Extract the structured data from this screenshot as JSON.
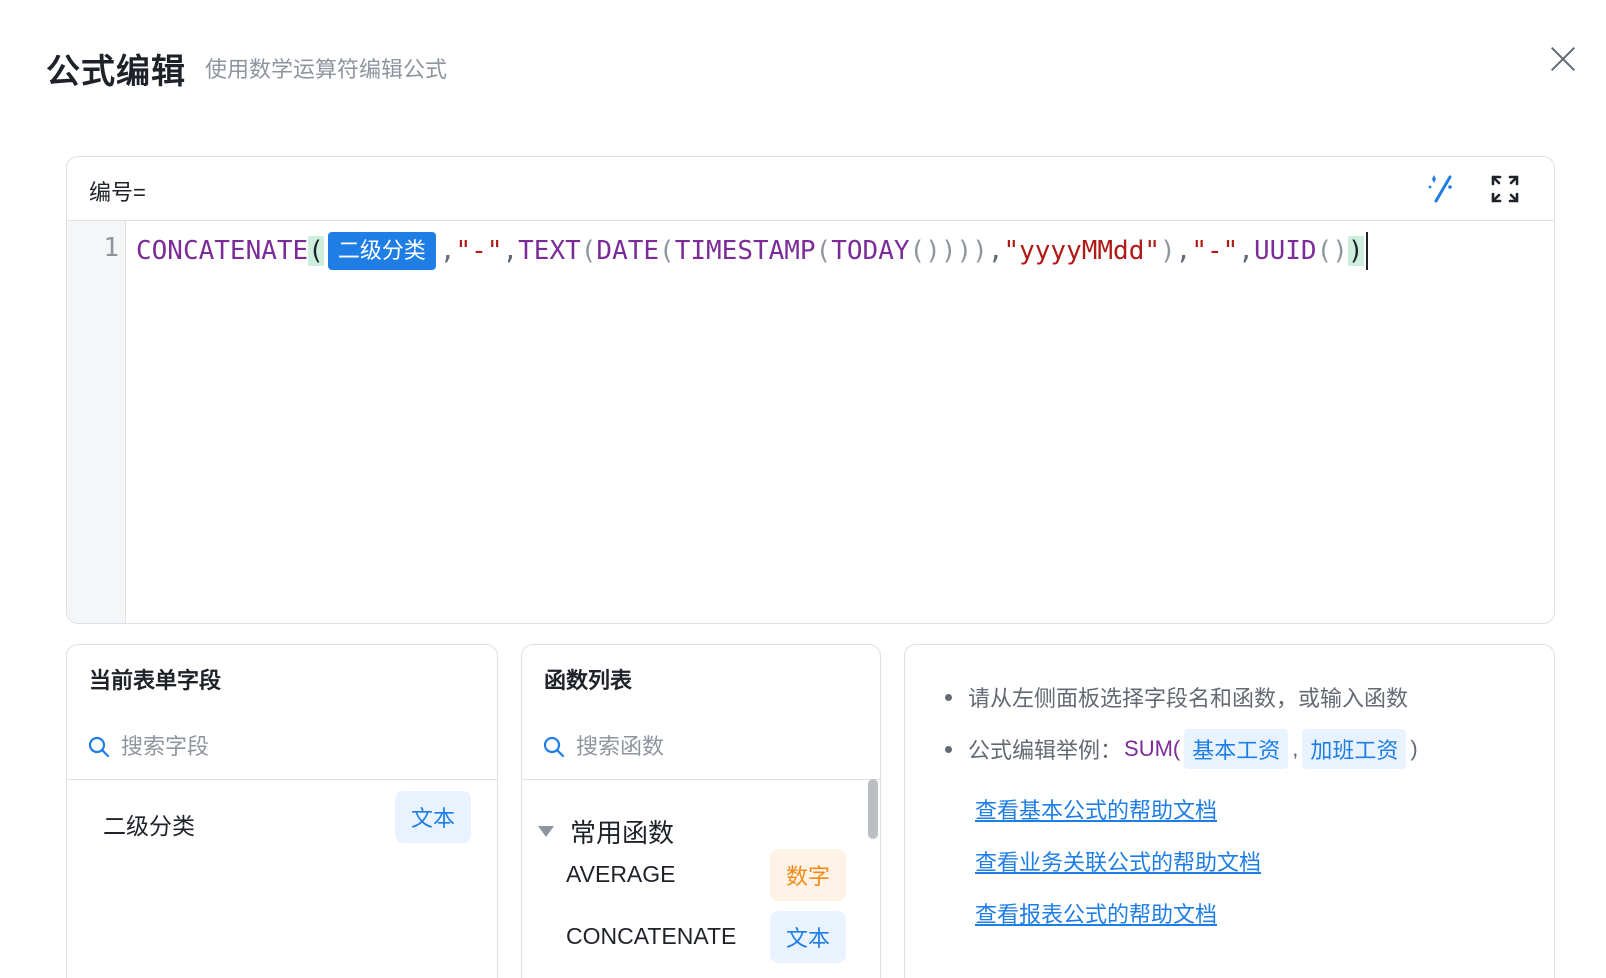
{
  "dialog": {
    "title": "公式编辑",
    "subtitle": "使用数学运算符编辑公式"
  },
  "editor": {
    "label": "编号=",
    "line_number": "1",
    "tokens": {
      "fn1": "CONCATENATE",
      "open1": "(",
      "field": "二级分类",
      "comma1": ",",
      "str1": "\"-\"",
      "comma2": ",",
      "fn2": "TEXT",
      "open2": "(",
      "fn3": "DATE",
      "open3": "(",
      "fn4": "TIMESTAMP",
      "open4": "(",
      "fn5": "TODAY",
      "parens5": "()",
      "close_run": ")))",
      "comma3": ",",
      "str2": "\"yyyyMMdd\"",
      "close2": ")",
      "comma4": ",",
      "str3": "\"-\"",
      "comma5": ",",
      "fn6": "UUID",
      "parens6": "()",
      "close1": ")"
    }
  },
  "fields_panel": {
    "title": "当前表单字段",
    "search_placeholder": "搜索字段",
    "items": [
      {
        "name": "二级分类",
        "type": "文本"
      }
    ]
  },
  "functions_panel": {
    "title": "函数列表",
    "search_placeholder": "搜索函数",
    "group_label": "常用函数",
    "items": [
      {
        "name": "AVERAGE",
        "type": "数字"
      },
      {
        "name": "CONCATENATE",
        "type": "文本"
      }
    ]
  },
  "help_panel": {
    "tip1": "请从左侧面板选择字段名和函数，或输入函数",
    "tip2_prefix": "公式编辑举例：",
    "tip2_fn": "SUM(",
    "tip2_arg1": "基本工资",
    "tip2_sep": ",",
    "tip2_arg2": "加班工资",
    "tip2_close": ")",
    "links": [
      "查看基本公式的帮助文档",
      "查看业务关联公式的帮助文档",
      "查看报表公式的帮助文档"
    ]
  },
  "colors": {
    "accent": "#1e7ee6",
    "function": "#7b2c98",
    "string": "#b01b17",
    "number_tag": "#f38b17"
  }
}
